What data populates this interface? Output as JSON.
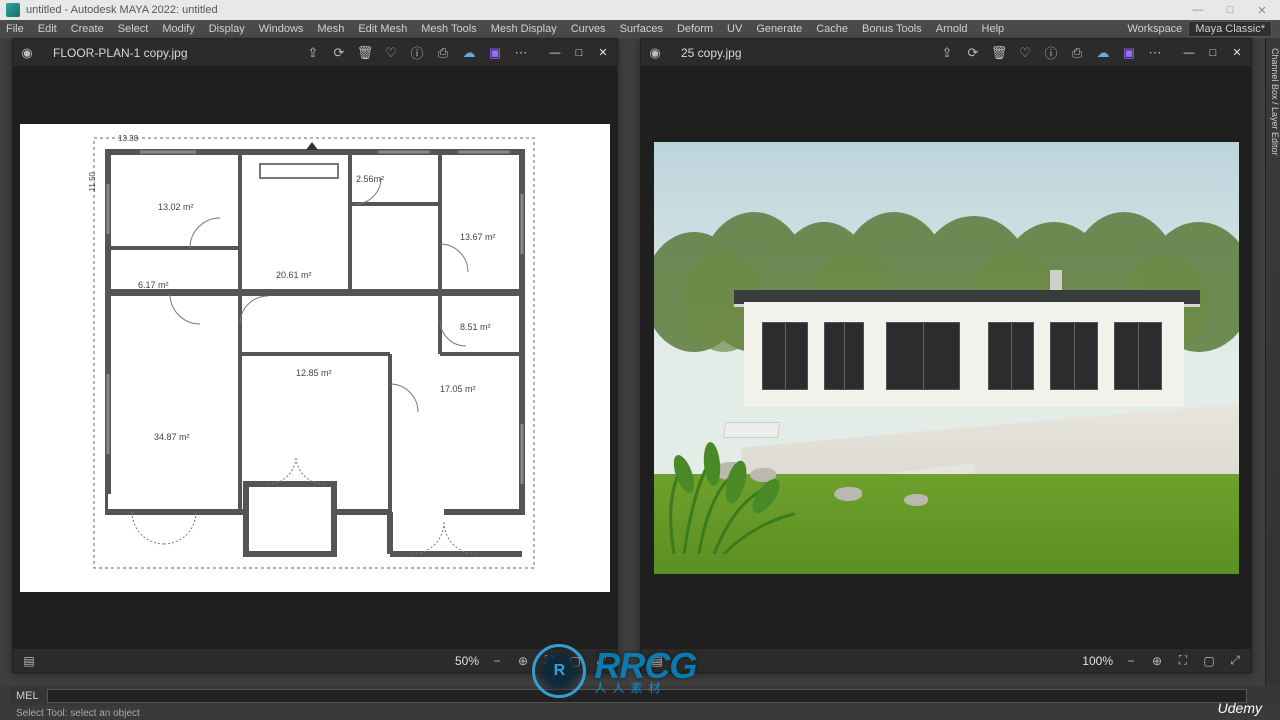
{
  "app": {
    "window_title": "untitled - Autodesk MAYA 2022: untitled",
    "workspace_label": "Workspace",
    "workspace_value": "Maya Classic*"
  },
  "menubar": [
    "File",
    "Edit",
    "Create",
    "Select",
    "Modify",
    "Display",
    "Windows",
    "Mesh",
    "Edit Mesh",
    "Mesh Tools",
    "Mesh Display",
    "Curves",
    "Surfaces",
    "Deform",
    "UV",
    "Generate",
    "Cache",
    "Bonus Tools",
    "Arnold",
    "Help"
  ],
  "viewer_left": {
    "filename": "FLOOR-PLAN-1 copy.jpg",
    "zoom": "50%"
  },
  "viewer_right": {
    "filename": "25 copy.jpg",
    "zoom": "100%"
  },
  "floorplan": {
    "dim_width": "13.38",
    "dim_height": "11.50",
    "rooms": {
      "r1": "13.02 m²",
      "r2": "2.56m²",
      "r3": "13.67 m²",
      "r4": "6.17 m²",
      "r5": "20.61 m²",
      "r6": "8.51 m²",
      "r7": "12.85 m²",
      "r8": "17.05 m²",
      "r9": "34.87 m²"
    }
  },
  "toolbar_icons": {
    "back": "back-icon",
    "share": "share-icon",
    "refresh": "refresh-icon",
    "delete": "trash-icon",
    "favorite": "heart-icon",
    "info": "info-circle-icon",
    "print": "print-icon",
    "cloud": "cloud-icon",
    "app": "app-icon",
    "more": "more-icon",
    "minimize": "minimize-icon",
    "maximize": "maximize-icon",
    "close": "close-icon",
    "zoom_out": "zoom-out-icon",
    "zoom_in": "zoom-in-icon",
    "aspect": "aspect-icon",
    "slideshow": "slideshow-icon",
    "fullscreen": "fullscreen-icon",
    "grid": "grid-icon"
  },
  "mel": {
    "tab": "MEL",
    "status": "Select Tool: select an object"
  },
  "panel_tab": "Channel Box / Layer Editor",
  "watermark": {
    "logo": "R",
    "main": "RRCG",
    "sub": "人人素材"
  },
  "brand": "Udemy"
}
